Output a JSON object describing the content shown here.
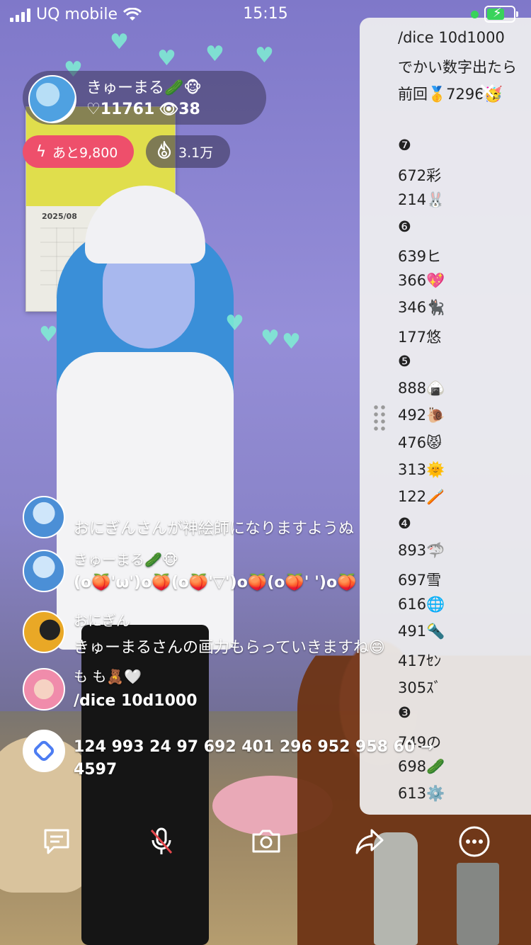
{
  "status_bar": {
    "carrier": "UQ mobile",
    "time": "15:15"
  },
  "host": {
    "name": "きゅーまる🥒🐵",
    "likes": "♡11761",
    "viewers": "👁38"
  },
  "goal_pill": {
    "label": "あと9,800"
  },
  "points_pill": {
    "label": "3.1万"
  },
  "calendar": {
    "month": "2025/08"
  },
  "side_panel": {
    "lines": [
      "/dice 10d1000",
      "でかい数字出たら",
      "前回🥇7296🥳",
      "",
      "❼",
      "672彩",
      "214🐰",
      "❻",
      "639ヒ",
      "366💖",
      "346🐈‍⬛",
      "177悠",
      "❺",
      "888🍙",
      "492🐌",
      "476😾",
      "313🌞",
      "122🪥",
      "❹",
      "893🦈",
      "697雪",
      "616🌐",
      "491🔦",
      "417ｾﾝ",
      "305ｽﾞ",
      "❸",
      "749の",
      "698🥒",
      "613⚙️"
    ]
  },
  "chat": [
    {
      "name": "",
      "message": "おにぎんさんが神絵師になりますようぬ"
    },
    {
      "name": "きゅーまる🥒🐵",
      "message": "(o🍑'ω')o🍑(o🍑'▽')o🍑(o🍑'  ')o🍑"
    },
    {
      "name": "おにぎん",
      "message": "きゅーまるさんの画力もらっていきますね😄"
    },
    {
      "name": "も も🧸🤍",
      "message": "/dice 10d1000"
    },
    {
      "name": "",
      "message": "124 993 24 97 692 401 296 952 958 60 →",
      "message2": "4597"
    }
  ],
  "colors": {
    "goal_pill": "#ee4f6b",
    "battery": "#38d35b",
    "mic_off": "#e5484d"
  }
}
